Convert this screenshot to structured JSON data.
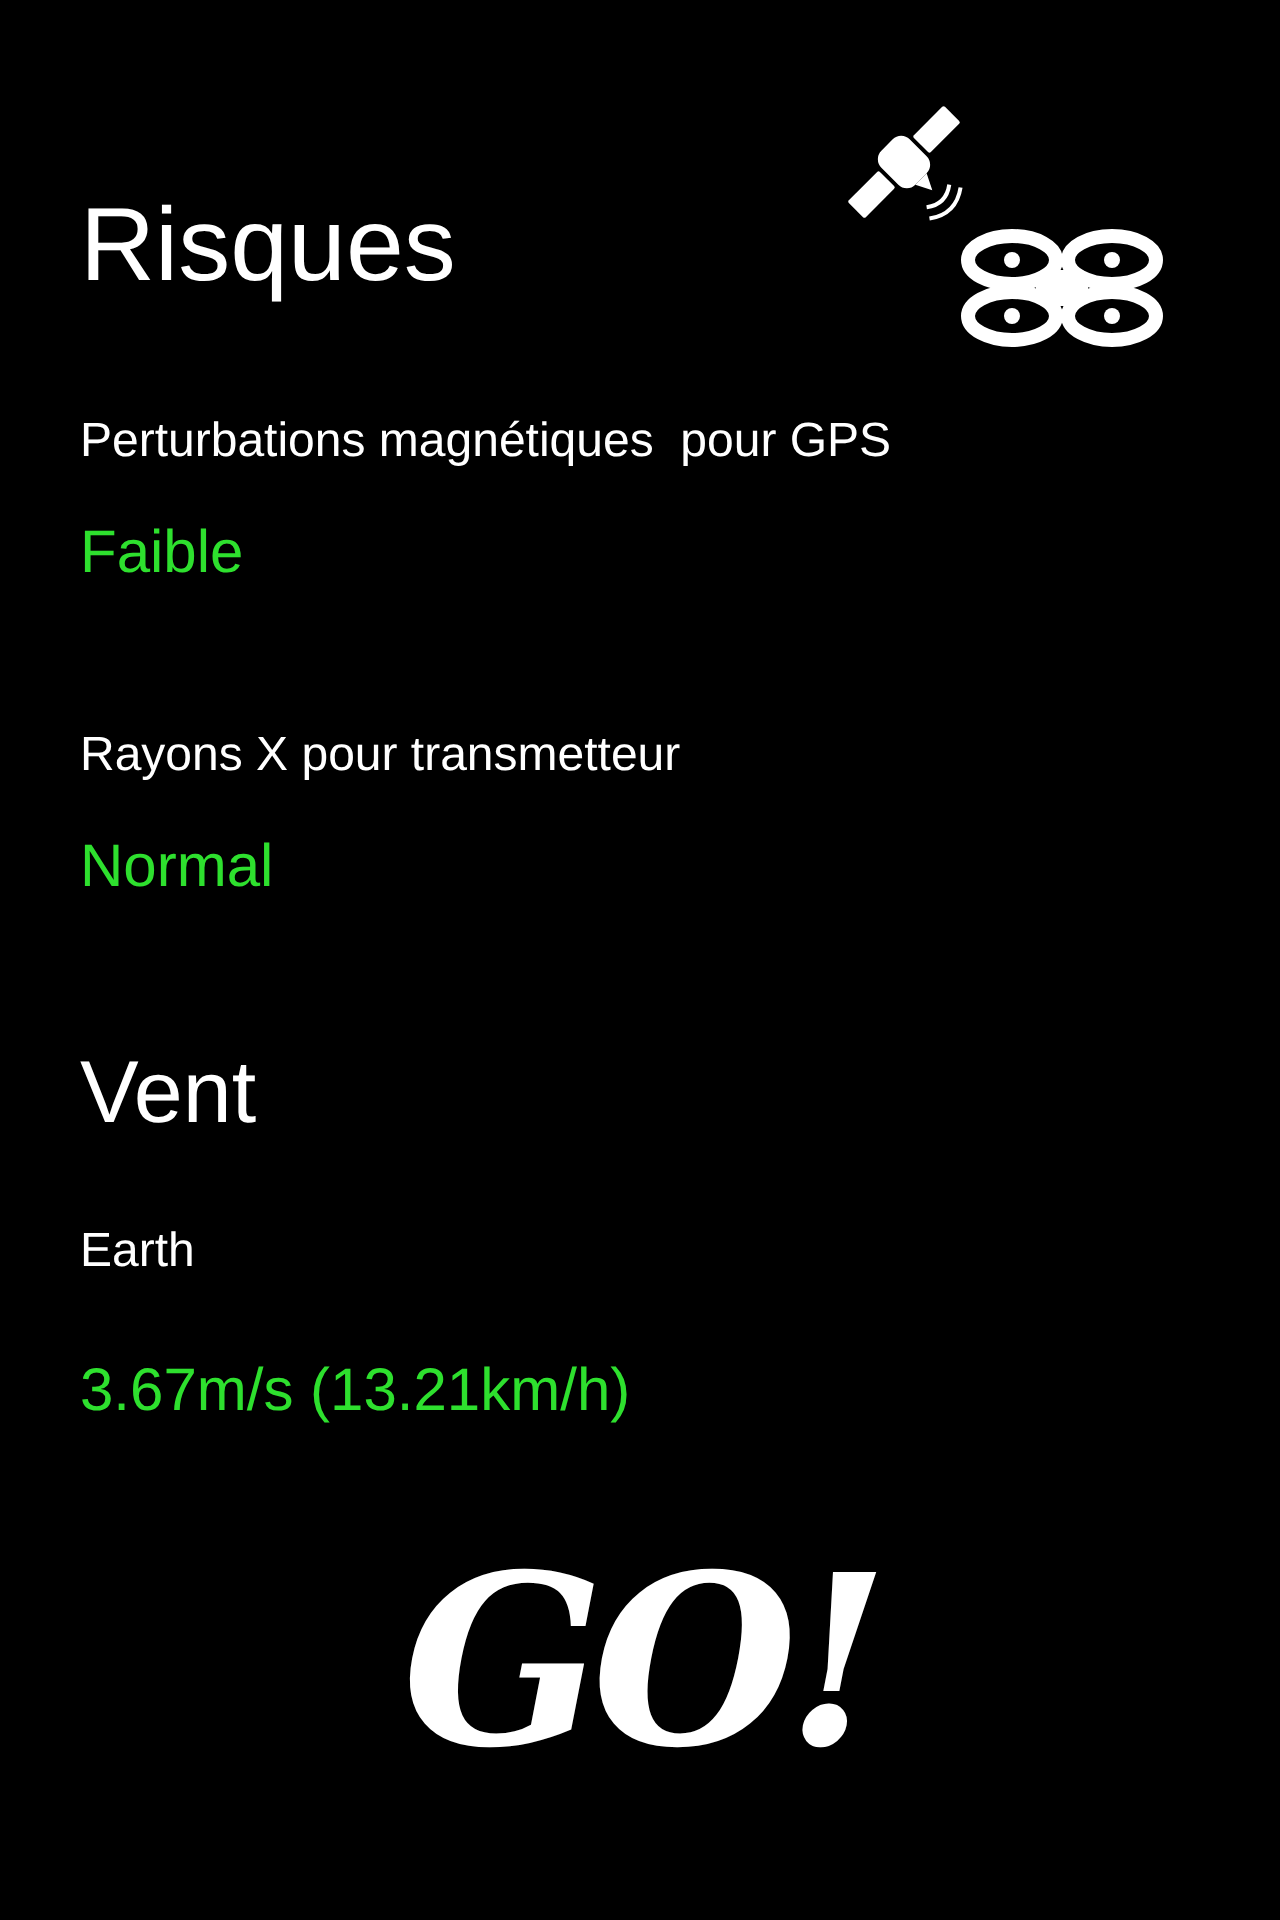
{
  "sections": [
    {
      "title": "Risques",
      "items": [
        {
          "label": "Perturbations magnétiques  pour GPS",
          "value": "Faible"
        },
        {
          "label": "Rayons X pour transmetteur",
          "value": "Normal"
        }
      ]
    },
    {
      "title": "Vent",
      "items": [
        {
          "label": "Earth",
          "value": "3.67m/s (13.21km/h)"
        }
      ]
    }
  ],
  "go_button": "GO!"
}
